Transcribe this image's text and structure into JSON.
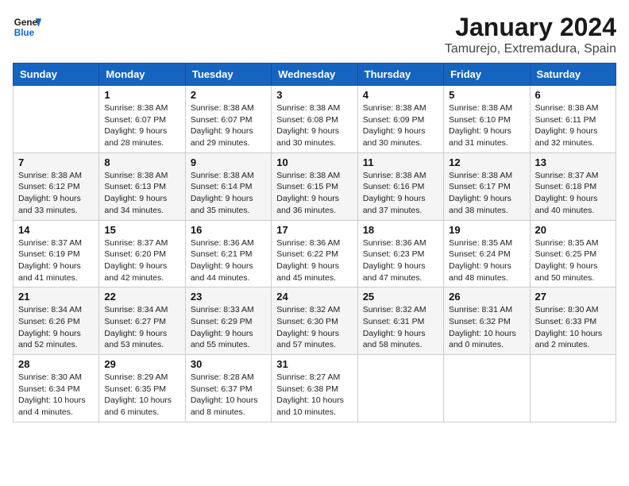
{
  "logo": {
    "line1": "General",
    "line2": "Blue"
  },
  "title": "January 2024",
  "subtitle": "Tamurejo, Extremadura, Spain",
  "headers": [
    "Sunday",
    "Monday",
    "Tuesday",
    "Wednesday",
    "Thursday",
    "Friday",
    "Saturday"
  ],
  "weeks": [
    [
      {
        "num": "",
        "info": ""
      },
      {
        "num": "1",
        "info": "Sunrise: 8:38 AM\nSunset: 6:07 PM\nDaylight: 9 hours\nand 28 minutes."
      },
      {
        "num": "2",
        "info": "Sunrise: 8:38 AM\nSunset: 6:07 PM\nDaylight: 9 hours\nand 29 minutes."
      },
      {
        "num": "3",
        "info": "Sunrise: 8:38 AM\nSunset: 6:08 PM\nDaylight: 9 hours\nand 30 minutes."
      },
      {
        "num": "4",
        "info": "Sunrise: 8:38 AM\nSunset: 6:09 PM\nDaylight: 9 hours\nand 30 minutes."
      },
      {
        "num": "5",
        "info": "Sunrise: 8:38 AM\nSunset: 6:10 PM\nDaylight: 9 hours\nand 31 minutes."
      },
      {
        "num": "6",
        "info": "Sunrise: 8:38 AM\nSunset: 6:11 PM\nDaylight: 9 hours\nand 32 minutes."
      }
    ],
    [
      {
        "num": "7",
        "info": "Sunrise: 8:38 AM\nSunset: 6:12 PM\nDaylight: 9 hours\nand 33 minutes."
      },
      {
        "num": "8",
        "info": "Sunrise: 8:38 AM\nSunset: 6:13 PM\nDaylight: 9 hours\nand 34 minutes."
      },
      {
        "num": "9",
        "info": "Sunrise: 8:38 AM\nSunset: 6:14 PM\nDaylight: 9 hours\nand 35 minutes."
      },
      {
        "num": "10",
        "info": "Sunrise: 8:38 AM\nSunset: 6:15 PM\nDaylight: 9 hours\nand 36 minutes."
      },
      {
        "num": "11",
        "info": "Sunrise: 8:38 AM\nSunset: 6:16 PM\nDaylight: 9 hours\nand 37 minutes."
      },
      {
        "num": "12",
        "info": "Sunrise: 8:38 AM\nSunset: 6:17 PM\nDaylight: 9 hours\nand 38 minutes."
      },
      {
        "num": "13",
        "info": "Sunrise: 8:37 AM\nSunset: 6:18 PM\nDaylight: 9 hours\nand 40 minutes."
      }
    ],
    [
      {
        "num": "14",
        "info": "Sunrise: 8:37 AM\nSunset: 6:19 PM\nDaylight: 9 hours\nand 41 minutes."
      },
      {
        "num": "15",
        "info": "Sunrise: 8:37 AM\nSunset: 6:20 PM\nDaylight: 9 hours\nand 42 minutes."
      },
      {
        "num": "16",
        "info": "Sunrise: 8:36 AM\nSunset: 6:21 PM\nDaylight: 9 hours\nand 44 minutes."
      },
      {
        "num": "17",
        "info": "Sunrise: 8:36 AM\nSunset: 6:22 PM\nDaylight: 9 hours\nand 45 minutes."
      },
      {
        "num": "18",
        "info": "Sunrise: 8:36 AM\nSunset: 6:23 PM\nDaylight: 9 hours\nand 47 minutes."
      },
      {
        "num": "19",
        "info": "Sunrise: 8:35 AM\nSunset: 6:24 PM\nDaylight: 9 hours\nand 48 minutes."
      },
      {
        "num": "20",
        "info": "Sunrise: 8:35 AM\nSunset: 6:25 PM\nDaylight: 9 hours\nand 50 minutes."
      }
    ],
    [
      {
        "num": "21",
        "info": "Sunrise: 8:34 AM\nSunset: 6:26 PM\nDaylight: 9 hours\nand 52 minutes."
      },
      {
        "num": "22",
        "info": "Sunrise: 8:34 AM\nSunset: 6:27 PM\nDaylight: 9 hours\nand 53 minutes."
      },
      {
        "num": "23",
        "info": "Sunrise: 8:33 AM\nSunset: 6:29 PM\nDaylight: 9 hours\nand 55 minutes."
      },
      {
        "num": "24",
        "info": "Sunrise: 8:32 AM\nSunset: 6:30 PM\nDaylight: 9 hours\nand 57 minutes."
      },
      {
        "num": "25",
        "info": "Sunrise: 8:32 AM\nSunset: 6:31 PM\nDaylight: 9 hours\nand 58 minutes."
      },
      {
        "num": "26",
        "info": "Sunrise: 8:31 AM\nSunset: 6:32 PM\nDaylight: 10 hours\nand 0 minutes."
      },
      {
        "num": "27",
        "info": "Sunrise: 8:30 AM\nSunset: 6:33 PM\nDaylight: 10 hours\nand 2 minutes."
      }
    ],
    [
      {
        "num": "28",
        "info": "Sunrise: 8:30 AM\nSunset: 6:34 PM\nDaylight: 10 hours\nand 4 minutes."
      },
      {
        "num": "29",
        "info": "Sunrise: 8:29 AM\nSunset: 6:35 PM\nDaylight: 10 hours\nand 6 minutes."
      },
      {
        "num": "30",
        "info": "Sunrise: 8:28 AM\nSunset: 6:37 PM\nDaylight: 10 hours\nand 8 minutes."
      },
      {
        "num": "31",
        "info": "Sunrise: 8:27 AM\nSunset: 6:38 PM\nDaylight: 10 hours\nand 10 minutes."
      },
      {
        "num": "",
        "info": ""
      },
      {
        "num": "",
        "info": ""
      },
      {
        "num": "",
        "info": ""
      }
    ]
  ]
}
